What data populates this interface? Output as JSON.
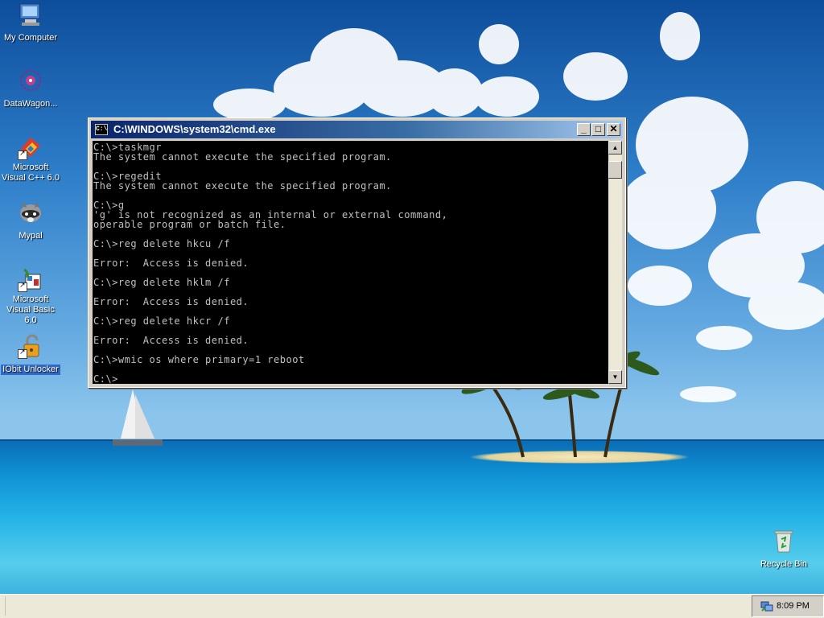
{
  "desktop": {
    "icons": [
      {
        "label": "My Computer",
        "icon": "my-computer-icon"
      },
      {
        "label": "DataWagon...",
        "icon": "datawagon-icon"
      },
      {
        "label": "Microsoft Visual C++ 6.0",
        "icon": "visual-cpp-icon"
      },
      {
        "label": "Mypal",
        "icon": "mypal-raccoon-icon"
      },
      {
        "label": "Microsoft Visual Basic 6.0",
        "icon": "visual-basic-icon"
      },
      {
        "label": "IObit Unlocker",
        "icon": "padlock-icon"
      },
      {
        "label": "Recycle Bin",
        "icon": "recycle-bin-icon"
      }
    ]
  },
  "cmd": {
    "title": "C:\\WINDOWS\\system32\\cmd.exe",
    "icon_text": "C:\\",
    "minimize": "_",
    "maximize": "□",
    "close": "✕",
    "output": "C:\\>taskmgr\nThe system cannot execute the specified program.\n\nC:\\>regedit\nThe system cannot execute the specified program.\n\nC:\\>g\n'g' is not recognized as an internal or external command,\noperable program or batch file.\n\nC:\\>reg delete hkcu /f\n\nError:  Access is denied.\n\nC:\\>reg delete hklm /f\n\nError:  Access is denied.\n\nC:\\>reg delete hkcr /f\n\nError:  Access is denied.\n\nC:\\>wmic os where primary=1 reboot\n\nC:\\>",
    "cursor": "_"
  },
  "taskbar": {
    "clock": "8:09 PM",
    "tray_icon": "network-tray-icon"
  },
  "colors": {
    "titlebar_start": "#0a246a",
    "titlebar_end": "#a6caf0",
    "console_bg": "#000000",
    "console_text": "#c0c0c0"
  }
}
